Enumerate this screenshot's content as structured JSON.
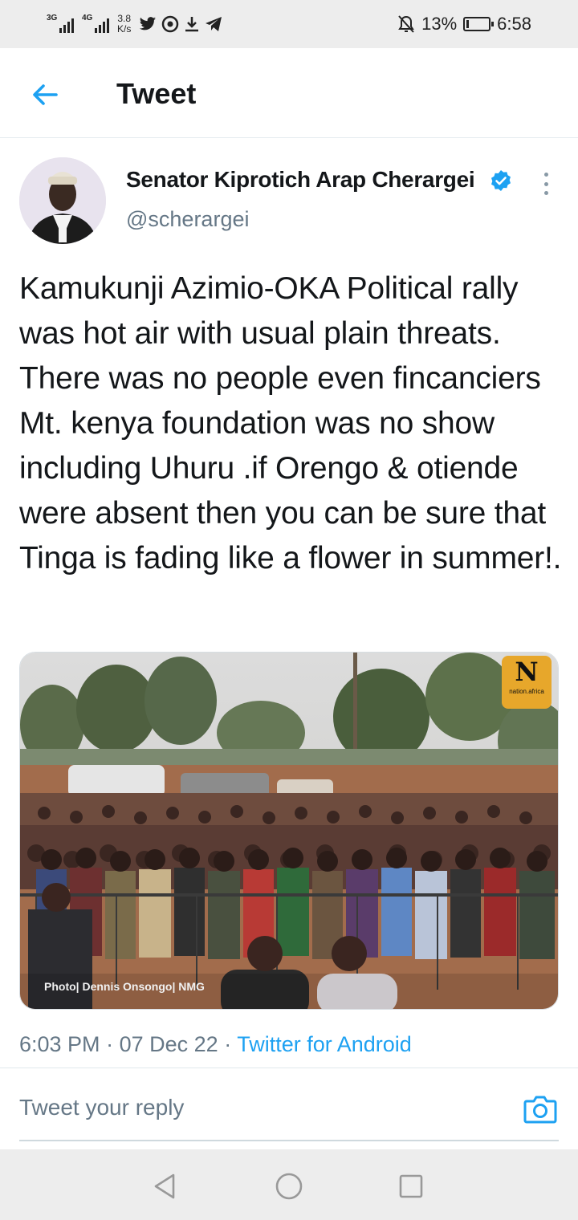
{
  "status_bar": {
    "network_1": "3G",
    "network_2": "4G",
    "speed_value": "3.8",
    "speed_unit": "K/s",
    "battery": "13%",
    "battery_level": 0.13,
    "time": "6:58",
    "icons": [
      "signal-3g-icon",
      "signal-4g-icon",
      "twitter-icon",
      "messenger-icon",
      "download-icon",
      "telegram-icon",
      "bell-off-icon",
      "battery-charging-icon"
    ]
  },
  "header": {
    "title": "Tweet"
  },
  "tweet": {
    "author_name": "Senator Kiprotich Arap Cherargei",
    "handle": "@scherargei",
    "verified": true,
    "text": "Kamukunji Azimio-OKA Political rally was hot air with usual plain threats. There was no people even fincanciers Mt. kenya foundation was no show including Uhuru .if Orengo & otiende were absent then you can be sure that Tinga is fading like a flower in summer!.",
    "media": {
      "logo_letter": "N",
      "logo_text": "nation.africa",
      "caption": "Photo| Dennis Onsongo| NMG"
    },
    "time": "6:03 PM",
    "date": "07 Dec 22",
    "separator": "·",
    "source": "Twitter for Android"
  },
  "reply": {
    "placeholder": "Tweet your reply"
  },
  "colors": {
    "accent": "#1da1f2",
    "secondary_text": "#657786",
    "logo": "#e7a72b"
  }
}
